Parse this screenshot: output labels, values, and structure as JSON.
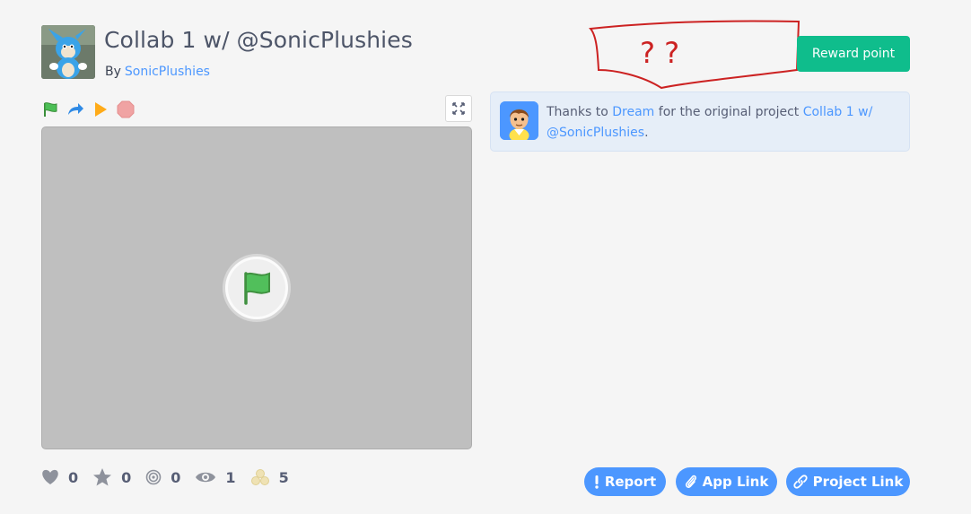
{
  "project": {
    "title": "Collab 1 w/ @SonicPlushies",
    "by_label": "By",
    "author": "SonicPlushies"
  },
  "reward_button": {
    "label": "Reward point"
  },
  "annotation": {
    "text": "? ?",
    "color": "#cc2222"
  },
  "player_controls": {
    "icons": [
      "green-flag-icon",
      "redo-icon",
      "play-icon",
      "stop-icon"
    ],
    "fullscreen_icon": "fullscreen-icon"
  },
  "credit": {
    "prefix": "Thanks to",
    "author": "Dream",
    "middle": "for the original project",
    "project": "Collab 1 w/ @SonicPlushies",
    "suffix": "."
  },
  "stats": {
    "loves": "0",
    "favorites": "0",
    "remixes": "0",
    "views": "1",
    "coins": "5"
  },
  "actions": {
    "report": "Report",
    "app_link": "App Link",
    "project_link": "Project Link"
  },
  "colors": {
    "primary": "#4c97ff",
    "green": "#0fbd8c",
    "text": "#575e75"
  }
}
